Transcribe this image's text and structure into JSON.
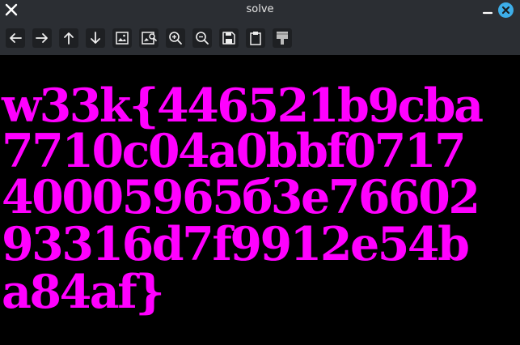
{
  "window": {
    "title": "solve"
  },
  "toolbar": {
    "buttons": [
      {
        "icon": "arrow-left-icon",
        "label": "Previous"
      },
      {
        "icon": "arrow-right-icon",
        "label": "Next"
      },
      {
        "icon": "arrow-up-icon",
        "label": "Up"
      },
      {
        "icon": "arrow-down-icon",
        "label": "Down"
      },
      {
        "icon": "image-icon",
        "label": "Image"
      },
      {
        "icon": "image-search-icon",
        "label": "Image search"
      },
      {
        "icon": "zoom-in-icon",
        "label": "Zoom in"
      },
      {
        "icon": "zoom-out-icon",
        "label": "Zoom out"
      },
      {
        "icon": "save-icon",
        "label": "Save"
      },
      {
        "icon": "clipboard-icon",
        "label": "Clipboard"
      },
      {
        "icon": "paint-brush-icon",
        "label": "Paint"
      }
    ]
  },
  "content": {
    "text_color": "#ff00ff",
    "background_color": "#000000",
    "lines": [
      "w33k{446521b9cba",
      "7710c04a0bbf0717",
      "40005965б3e76602",
      "93316d7f9912e54b",
      "a84af}"
    ]
  }
}
